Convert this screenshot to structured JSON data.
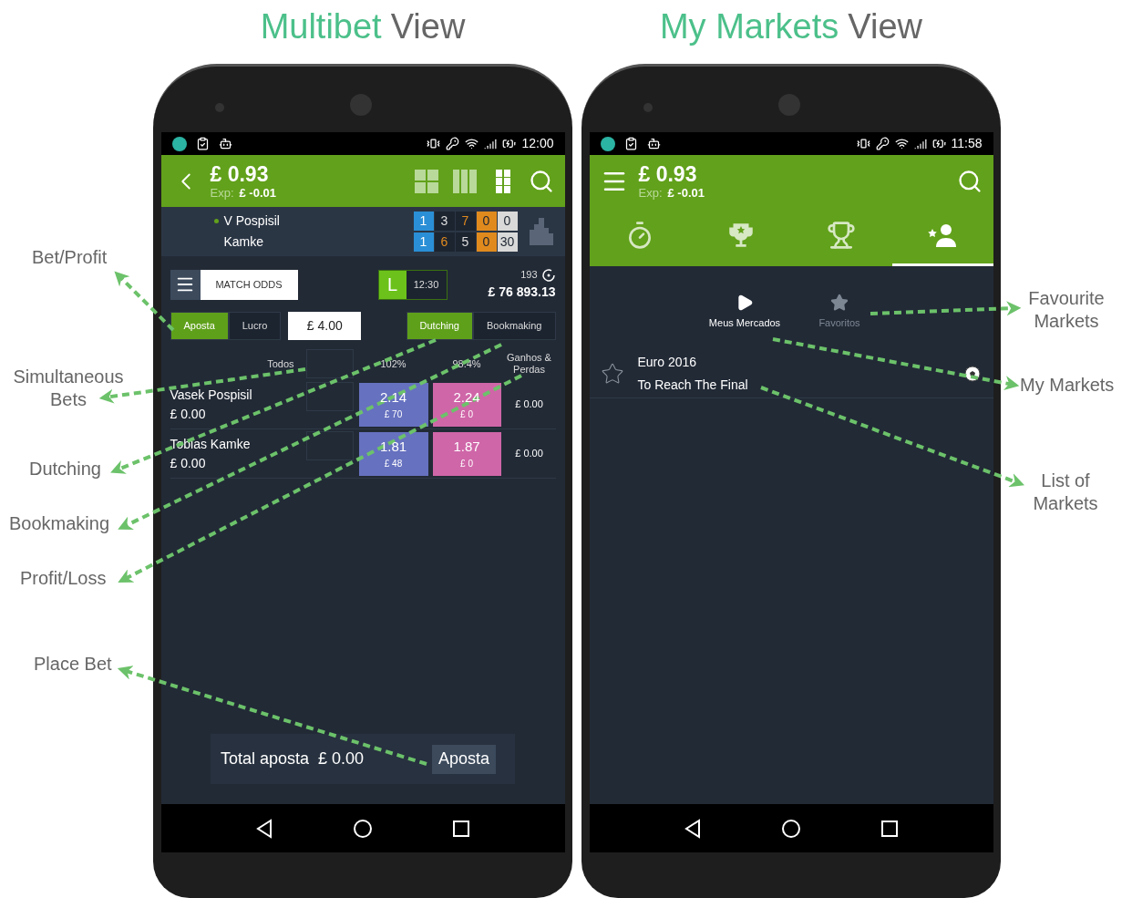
{
  "titles": [
    {
      "highlight": "Multibet",
      "rest": "View"
    },
    {
      "highlight": "My Markets",
      "rest": "View"
    }
  ],
  "multibet": {
    "status_time": "12:00",
    "balance": "£ 0.93",
    "exposure_label": "Exp:",
    "exposure": "£ -0.01",
    "view_modes": [
      {
        "kind": "grid",
        "selected": false
      },
      {
        "kind": "columns",
        "selected": false
      },
      {
        "kind": "tiles",
        "selected": true
      }
    ],
    "players": [
      {
        "name": "V Pospisil",
        "serving": true,
        "scores": [
          {
            "value": "1",
            "kind": "sets"
          },
          {
            "value": "3",
            "kind": "games"
          },
          {
            "value": "7",
            "kind": "games_leading"
          },
          {
            "value": "0",
            "kind": "current"
          },
          {
            "value": "0",
            "kind": "points"
          }
        ]
      },
      {
        "name": "Kamke",
        "serving": false,
        "scores": [
          {
            "value": "1",
            "kind": "sets"
          },
          {
            "value": "6",
            "kind": "games_leading"
          },
          {
            "value": "5",
            "kind": "games"
          },
          {
            "value": "0",
            "kind": "current"
          },
          {
            "value": "30",
            "kind": "points"
          }
        ]
      }
    ],
    "market": {
      "name": "MATCH ODDS",
      "live_badge": "L",
      "time": "12:30",
      "count": "193",
      "matched": "£ 76 893.13"
    },
    "stake_modes": [
      {
        "label": "Aposta",
        "selected": true
      },
      {
        "label": "Lucro",
        "selected": false
      }
    ],
    "stake": "£ 4.00",
    "strategy_modes": [
      {
        "label": "Dutching",
        "selected": true
      },
      {
        "label": "Bookmaking",
        "selected": false
      }
    ],
    "columns": {
      "all": "Todos",
      "back_book": "102%",
      "lay_book": "98.4%",
      "pnl": "Ganhos & Perdas"
    },
    "runners": [
      {
        "name": "Vasek Pospisil",
        "stake": "£ 0.00",
        "back": {
          "odds": "2.14",
          "amount": "£ 70"
        },
        "lay": {
          "odds": "2.24",
          "amount": "£ 0"
        },
        "pnl": "£ 0.00"
      },
      {
        "name": "Tobias Kamke",
        "stake": "£ 0.00",
        "back": {
          "odds": "1.81",
          "amount": "£ 48"
        },
        "lay": {
          "odds": "1.87",
          "amount": "£ 0"
        },
        "pnl": "£ 0.00"
      }
    ],
    "footer": {
      "total_label": "Total aposta",
      "total": "£ 0.00",
      "button": "Aposta"
    }
  },
  "my_markets": {
    "status_time": "11:58",
    "balance": "£ 0.93",
    "exposure_label": "Exp:",
    "exposure": "£ -0.01",
    "tabs": [
      {
        "kind": "stopwatch",
        "selected": false
      },
      {
        "kind": "trophy_star",
        "selected": false
      },
      {
        "kind": "trophy",
        "selected": false
      },
      {
        "kind": "user_star",
        "selected": true
      }
    ],
    "filters": [
      {
        "label": "Meus Mercados",
        "kind": "play",
        "selected": true
      },
      {
        "label": "Favoritos",
        "kind": "star",
        "selected": false
      }
    ],
    "markets": [
      {
        "event": "Euro 2016",
        "market": "To Reach The Final",
        "favourite": false
      }
    ]
  },
  "annotations": [
    "Bet/Profit",
    "Simultaneous Bets",
    "Dutching",
    "Bookmaking",
    "Profit/Loss",
    "Place Bet",
    "Favourite Markets",
    "My Markets",
    "List of Markets"
  ]
}
